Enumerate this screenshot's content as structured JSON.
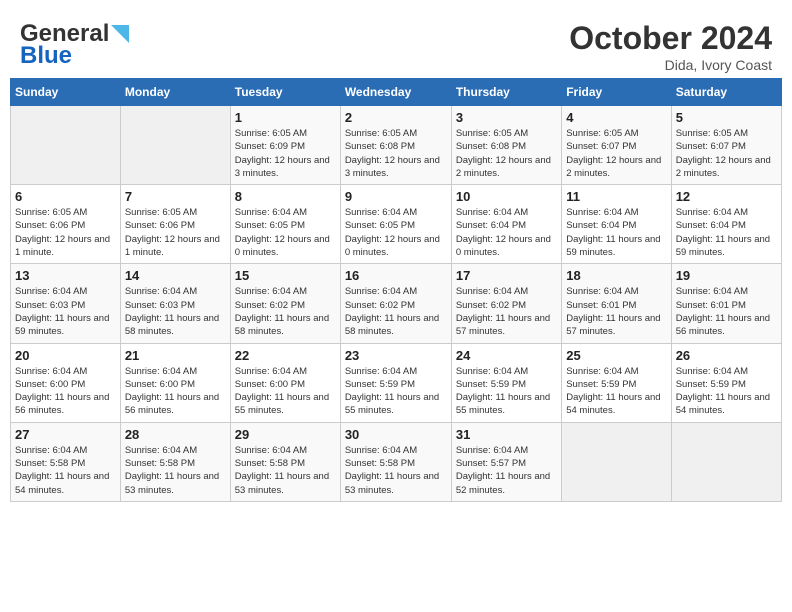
{
  "header": {
    "logo_general": "General",
    "logo_blue": "Blue",
    "month_title": "October 2024",
    "location": "Dida, Ivory Coast"
  },
  "weekdays": [
    "Sunday",
    "Monday",
    "Tuesday",
    "Wednesday",
    "Thursday",
    "Friday",
    "Saturday"
  ],
  "weeks": [
    [
      {
        "day": "",
        "info": ""
      },
      {
        "day": "",
        "info": ""
      },
      {
        "day": "1",
        "info": "Sunrise: 6:05 AM\nSunset: 6:09 PM\nDaylight: 12 hours and 3 minutes."
      },
      {
        "day": "2",
        "info": "Sunrise: 6:05 AM\nSunset: 6:08 PM\nDaylight: 12 hours and 3 minutes."
      },
      {
        "day": "3",
        "info": "Sunrise: 6:05 AM\nSunset: 6:08 PM\nDaylight: 12 hours and 2 minutes."
      },
      {
        "day": "4",
        "info": "Sunrise: 6:05 AM\nSunset: 6:07 PM\nDaylight: 12 hours and 2 minutes."
      },
      {
        "day": "5",
        "info": "Sunrise: 6:05 AM\nSunset: 6:07 PM\nDaylight: 12 hours and 2 minutes."
      }
    ],
    [
      {
        "day": "6",
        "info": "Sunrise: 6:05 AM\nSunset: 6:06 PM\nDaylight: 12 hours and 1 minute."
      },
      {
        "day": "7",
        "info": "Sunrise: 6:05 AM\nSunset: 6:06 PM\nDaylight: 12 hours and 1 minute."
      },
      {
        "day": "8",
        "info": "Sunrise: 6:04 AM\nSunset: 6:05 PM\nDaylight: 12 hours and 0 minutes."
      },
      {
        "day": "9",
        "info": "Sunrise: 6:04 AM\nSunset: 6:05 PM\nDaylight: 12 hours and 0 minutes."
      },
      {
        "day": "10",
        "info": "Sunrise: 6:04 AM\nSunset: 6:04 PM\nDaylight: 12 hours and 0 minutes."
      },
      {
        "day": "11",
        "info": "Sunrise: 6:04 AM\nSunset: 6:04 PM\nDaylight: 11 hours and 59 minutes."
      },
      {
        "day": "12",
        "info": "Sunrise: 6:04 AM\nSunset: 6:04 PM\nDaylight: 11 hours and 59 minutes."
      }
    ],
    [
      {
        "day": "13",
        "info": "Sunrise: 6:04 AM\nSunset: 6:03 PM\nDaylight: 11 hours and 59 minutes."
      },
      {
        "day": "14",
        "info": "Sunrise: 6:04 AM\nSunset: 6:03 PM\nDaylight: 11 hours and 58 minutes."
      },
      {
        "day": "15",
        "info": "Sunrise: 6:04 AM\nSunset: 6:02 PM\nDaylight: 11 hours and 58 minutes."
      },
      {
        "day": "16",
        "info": "Sunrise: 6:04 AM\nSunset: 6:02 PM\nDaylight: 11 hours and 58 minutes."
      },
      {
        "day": "17",
        "info": "Sunrise: 6:04 AM\nSunset: 6:02 PM\nDaylight: 11 hours and 57 minutes."
      },
      {
        "day": "18",
        "info": "Sunrise: 6:04 AM\nSunset: 6:01 PM\nDaylight: 11 hours and 57 minutes."
      },
      {
        "day": "19",
        "info": "Sunrise: 6:04 AM\nSunset: 6:01 PM\nDaylight: 11 hours and 56 minutes."
      }
    ],
    [
      {
        "day": "20",
        "info": "Sunrise: 6:04 AM\nSunset: 6:00 PM\nDaylight: 11 hours and 56 minutes."
      },
      {
        "day": "21",
        "info": "Sunrise: 6:04 AM\nSunset: 6:00 PM\nDaylight: 11 hours and 56 minutes."
      },
      {
        "day": "22",
        "info": "Sunrise: 6:04 AM\nSunset: 6:00 PM\nDaylight: 11 hours and 55 minutes."
      },
      {
        "day": "23",
        "info": "Sunrise: 6:04 AM\nSunset: 5:59 PM\nDaylight: 11 hours and 55 minutes."
      },
      {
        "day": "24",
        "info": "Sunrise: 6:04 AM\nSunset: 5:59 PM\nDaylight: 11 hours and 55 minutes."
      },
      {
        "day": "25",
        "info": "Sunrise: 6:04 AM\nSunset: 5:59 PM\nDaylight: 11 hours and 54 minutes."
      },
      {
        "day": "26",
        "info": "Sunrise: 6:04 AM\nSunset: 5:59 PM\nDaylight: 11 hours and 54 minutes."
      }
    ],
    [
      {
        "day": "27",
        "info": "Sunrise: 6:04 AM\nSunset: 5:58 PM\nDaylight: 11 hours and 54 minutes."
      },
      {
        "day": "28",
        "info": "Sunrise: 6:04 AM\nSunset: 5:58 PM\nDaylight: 11 hours and 53 minutes."
      },
      {
        "day": "29",
        "info": "Sunrise: 6:04 AM\nSunset: 5:58 PM\nDaylight: 11 hours and 53 minutes."
      },
      {
        "day": "30",
        "info": "Sunrise: 6:04 AM\nSunset: 5:58 PM\nDaylight: 11 hours and 53 minutes."
      },
      {
        "day": "31",
        "info": "Sunrise: 6:04 AM\nSunset: 5:57 PM\nDaylight: 11 hours and 52 minutes."
      },
      {
        "day": "",
        "info": ""
      },
      {
        "day": "",
        "info": ""
      }
    ]
  ]
}
